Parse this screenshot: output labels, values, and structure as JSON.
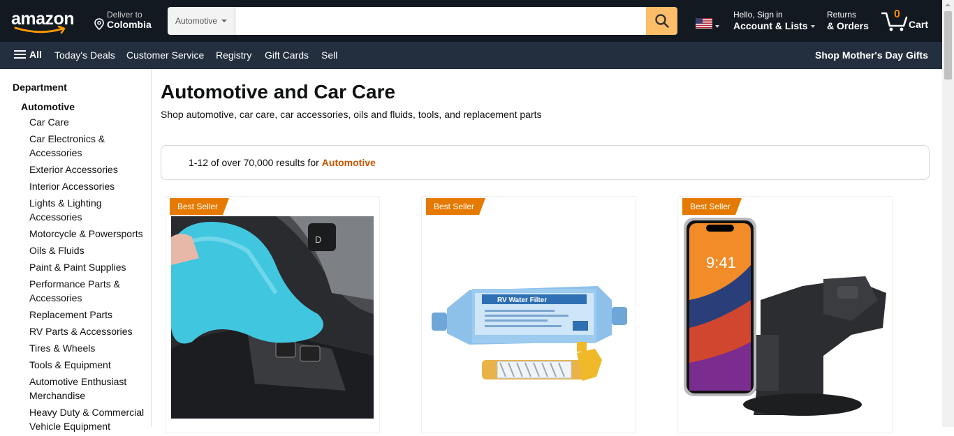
{
  "nav": {
    "logo_text": "amazon",
    "deliver_line1": "Deliver to",
    "deliver_line2": "Colombia",
    "search_category": "Automotive",
    "search_placeholder": "",
    "account_line1": "Hello, Sign in",
    "account_line2": "Account & Lists",
    "returns_line1": "Returns",
    "returns_line2": "& Orders",
    "cart_count": "0",
    "cart_label": "Cart"
  },
  "subnav": {
    "all_label": "All",
    "items": [
      "Today's Deals",
      "Customer Service",
      "Registry",
      "Gift Cards",
      "Sell"
    ],
    "promo": "Shop Mother's Day Gifts"
  },
  "sidebar": {
    "department_label": "Department",
    "current": "Automotive",
    "items": [
      "Car Care",
      "Car Electronics & Accessories",
      "Exterior Accessories",
      "Interior Accessories",
      "Lights & Lighting Accessories",
      "Motorcycle & Powersports",
      "Oils & Fluids",
      "Paint & Paint Supplies",
      "Performance Parts & Accessories",
      "Replacement Parts",
      "RV Parts & Accessories",
      "Tires & Wheels",
      "Tools & Equipment",
      "Automotive Enthusiast Merchandise",
      "Heavy Duty & Commercial Vehicle Equipment"
    ]
  },
  "main": {
    "title": "Automotive and Car Care",
    "subtitle": "Shop automotive, car care, car accessories, oils and fluids, tools, and replacement parts",
    "results_prefix": "1-12 of over 70,000 results for",
    "results_query": "Automotive"
  },
  "products": [
    {
      "badge": "Best Seller",
      "image": "cleaning-gel-image"
    },
    {
      "badge": "Best Seller",
      "image": "rv-water-filter-image",
      "filter_label": "RV Water Filter"
    },
    {
      "badge": "Best Seller",
      "image": "phone-car-mount-image",
      "phone_time": "9:41"
    }
  ],
  "colors": {
    "nav_bg": "#131921",
    "subnav_bg": "#232f3e",
    "search_button": "#febd69",
    "badge": "#e67a00",
    "query_link": "#c45500",
    "cart_count": "#f08804"
  }
}
